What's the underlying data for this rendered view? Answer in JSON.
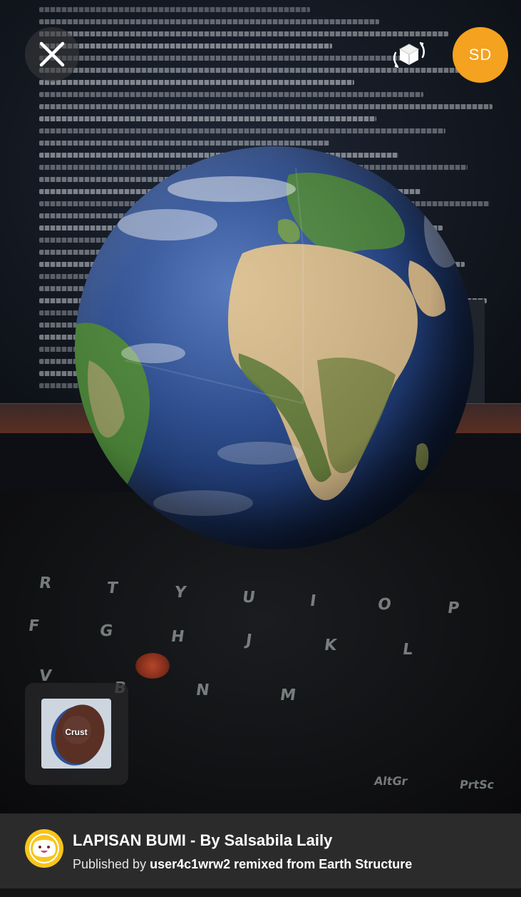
{
  "header": {
    "close_icon": "close-icon",
    "ar_view_icon": "ar-cube-rotate-icon",
    "avatar_initials": "SD",
    "avatar_color": "#f4a21f"
  },
  "scene": {
    "model": "earth-globe",
    "layer_thumbnail": {
      "label": "Crust"
    }
  },
  "footer": {
    "logo_icon": "merge-cube-logo-icon",
    "logo_color": "#f7c51c",
    "title": "LAPISAN BUMI - By Salsabila Laily",
    "published_prefix": "Published by",
    "publisher": "user4c1wrw2 remixed from Earth Structure"
  }
}
